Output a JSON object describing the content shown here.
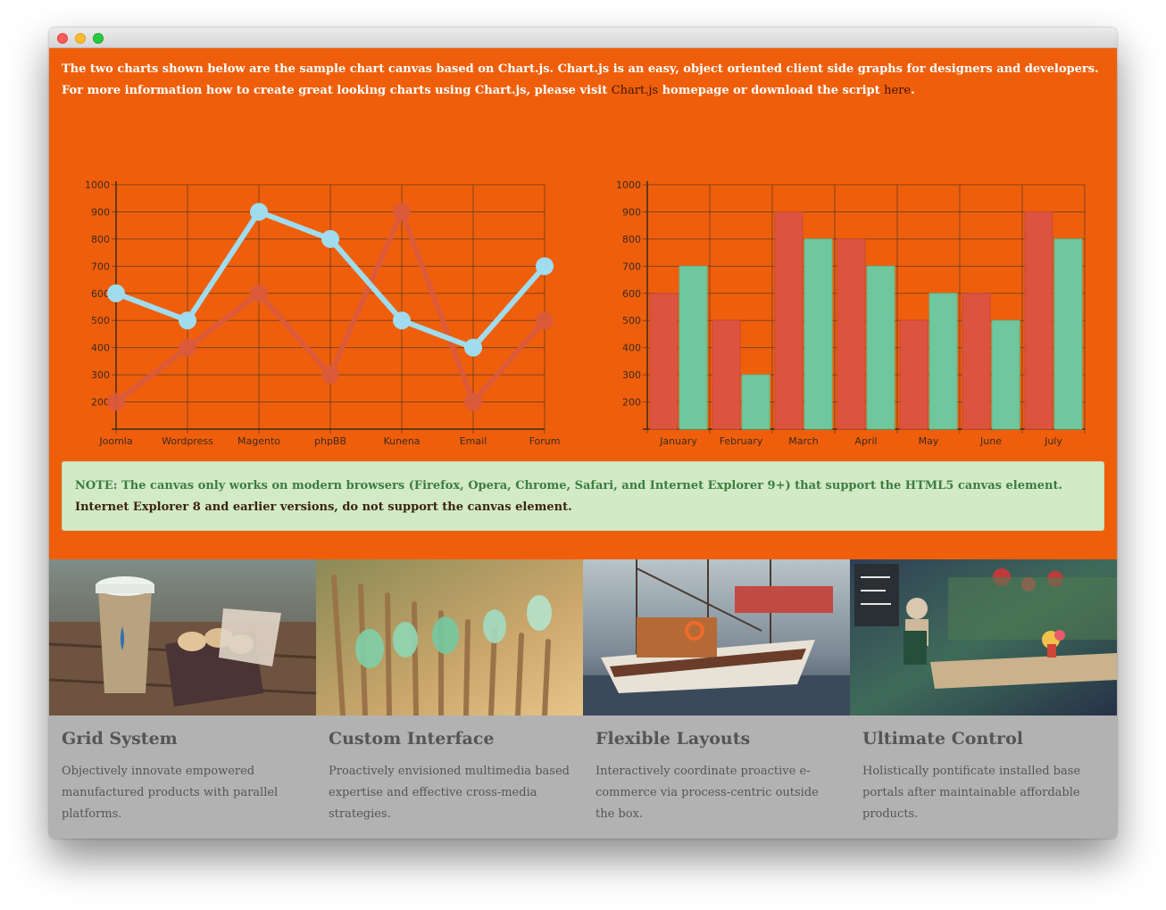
{
  "intro": {
    "text_before": "The two charts shown below are the sample chart canvas based on Chart.js. Chart.js is an easy, object oriented client side graphs for designers and developers. For more information how to create great looking charts using Chart.js, please visit ",
    "link1": "Chart.js",
    "text_middle": " homepage or download the script ",
    "link2": "here",
    "text_after": "."
  },
  "chart_data": [
    {
      "type": "line",
      "categories": [
        "Joomla",
        "Wordpress",
        "Magento",
        "phpBB",
        "Kunena",
        "Email",
        "Forum"
      ],
      "series": [
        {
          "values": [
            200,
            400,
            600,
            300,
            900,
            200,
            500
          ],
          "color": "#d95a3d"
        },
        {
          "values": [
            600,
            500,
            900,
            800,
            500,
            400,
            700
          ],
          "color": "#9fdcef"
        }
      ],
      "y_ticks": [
        200,
        300,
        400,
        500,
        600,
        700,
        800,
        900,
        1000
      ],
      "ylim": [
        100,
        1000
      ],
      "grid": true
    },
    {
      "type": "bar",
      "categories": [
        "January",
        "February",
        "March",
        "April",
        "May",
        "June",
        "July"
      ],
      "series": [
        {
          "values": [
            600,
            500,
            900,
            800,
            500,
            600,
            900
          ],
          "color": "#dc5440"
        },
        {
          "values": [
            700,
            300,
            800,
            700,
            600,
            500,
            800
          ],
          "color": "#6fc79e"
        }
      ],
      "y_ticks": [
        200,
        300,
        400,
        500,
        600,
        700,
        800,
        900,
        1000
      ],
      "ylim": [
        100,
        1000
      ],
      "grid": true
    }
  ],
  "note": {
    "green_text": "NOTE: The canvas only works on modern browsers (Firefox, Opera, Chrome, Safari, and Internet Explorer 9+) that support the HTML5 canvas element.",
    "dark_text": " Internet Explorer 8 and earlier versions, do not support the canvas element."
  },
  "features": [
    {
      "title": "Grid System",
      "description": "Objectively innovate empowered manufactured products with parallel platforms."
    },
    {
      "title": "Custom Interface",
      "description": "Proactively envisioned multimedia based expertise and effective cross-media strategies."
    },
    {
      "title": "Flexible Layouts",
      "description": "Interactively coordinate proactive e-commerce via process-centric outside the box."
    },
    {
      "title": "Ultimate Control",
      "description": "Holistically pontificate installed base portals after maintainable affordable products."
    }
  ],
  "colors": {
    "page_background": "#ef5f0b",
    "line_series_1": "#d95a3d",
    "line_series_2": "#9fdcef",
    "bar_series_1": "#dc5440",
    "bar_series_2": "#6fc79e",
    "note_background": "#d2eac6"
  }
}
